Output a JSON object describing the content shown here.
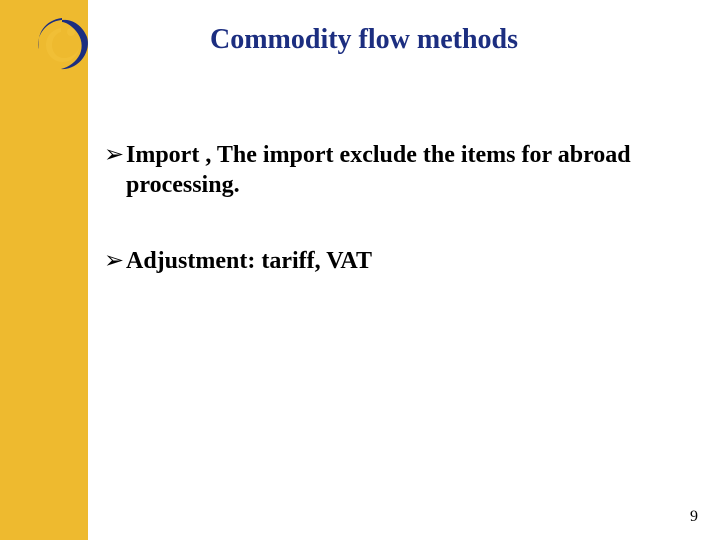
{
  "title": "Commodity flow methods",
  "bullets": [
    "Import , The import exclude the items for abroad processing.",
    "Adjustment: tariff, VAT"
  ],
  "page_number": "9",
  "colors": {
    "sidebar": "#eeba2f",
    "title": "#1c2e80",
    "logo_dark": "#1c2e80",
    "logo_light": "#f1bf36"
  }
}
